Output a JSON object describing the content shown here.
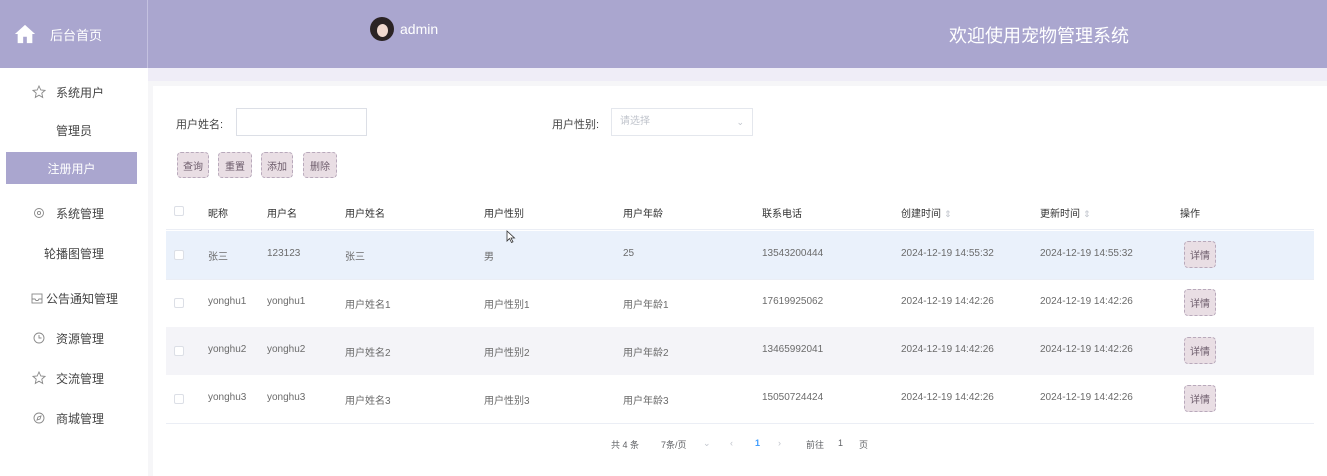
{
  "header": {
    "brand_label": "后台首页",
    "username": "admin",
    "welcome": "欢迎使用宠物管理系统"
  },
  "sidebar": {
    "items": [
      {
        "label": "系统用户",
        "icon": "star-icon"
      },
      {
        "label": "管理员"
      },
      {
        "label": "注册用户",
        "active": true
      },
      {
        "label": "系统管理",
        "icon": "gear-icon"
      },
      {
        "label": "轮播图管理"
      },
      {
        "label": "公告通知管理",
        "icon": "inbox-icon"
      },
      {
        "label": "资源管理",
        "icon": "clock-icon"
      },
      {
        "label": "交流管理",
        "icon": "star-icon"
      },
      {
        "label": "商城管理",
        "icon": "compass-icon"
      }
    ]
  },
  "search": {
    "name_label": "用户姓名:",
    "name_value": "",
    "gender_label": "用户性别:",
    "gender_placeholder": "请选择"
  },
  "actions": {
    "query": "查询",
    "reset": "重置",
    "add": "添加",
    "delete": "删除"
  },
  "table": {
    "columns": [
      "昵称",
      "用户名",
      "用户姓名",
      "用户性别",
      "用户年龄",
      "联系电话",
      "创建时间",
      "更新时间",
      "操作"
    ],
    "rows": [
      {
        "nickname": "张三",
        "username": "123123",
        "realname": "张三",
        "gender": "男",
        "age": "25",
        "phone": "13543200444",
        "created": "2024-12-19 14:55:32",
        "updated": "2024-12-19 14:55:32"
      },
      {
        "nickname": "yonghu1",
        "username": "yonghu1",
        "realname": "用户姓名1",
        "gender": "用户性别1",
        "age": "用户年龄1",
        "phone": "17619925062",
        "created": "2024-12-19 14:42:26",
        "updated": "2024-12-19 14:42:26"
      },
      {
        "nickname": "yonghu2",
        "username": "yonghu2",
        "realname": "用户姓名2",
        "gender": "用户性别2",
        "age": "用户年龄2",
        "phone": "13465992041",
        "created": "2024-12-19 14:42:26",
        "updated": "2024-12-19 14:42:26"
      },
      {
        "nickname": "yonghu3",
        "username": "yonghu3",
        "realname": "用户姓名3",
        "gender": "用户性别3",
        "age": "用户年龄3",
        "phone": "15050724424",
        "created": "2024-12-19 14:42:26",
        "updated": "2024-12-19 14:42:26"
      }
    ],
    "detail_label": "详情"
  },
  "pagination": {
    "total": "共 4 条",
    "page_size": "7条/页",
    "current_page": "1",
    "goto_label": "前往",
    "goto_value": "1",
    "page_suffix": "页"
  },
  "colors": {
    "accent": "#aaa6cf",
    "button_bg": "#e9dee4",
    "highlight_row": "#eaf1fb"
  }
}
